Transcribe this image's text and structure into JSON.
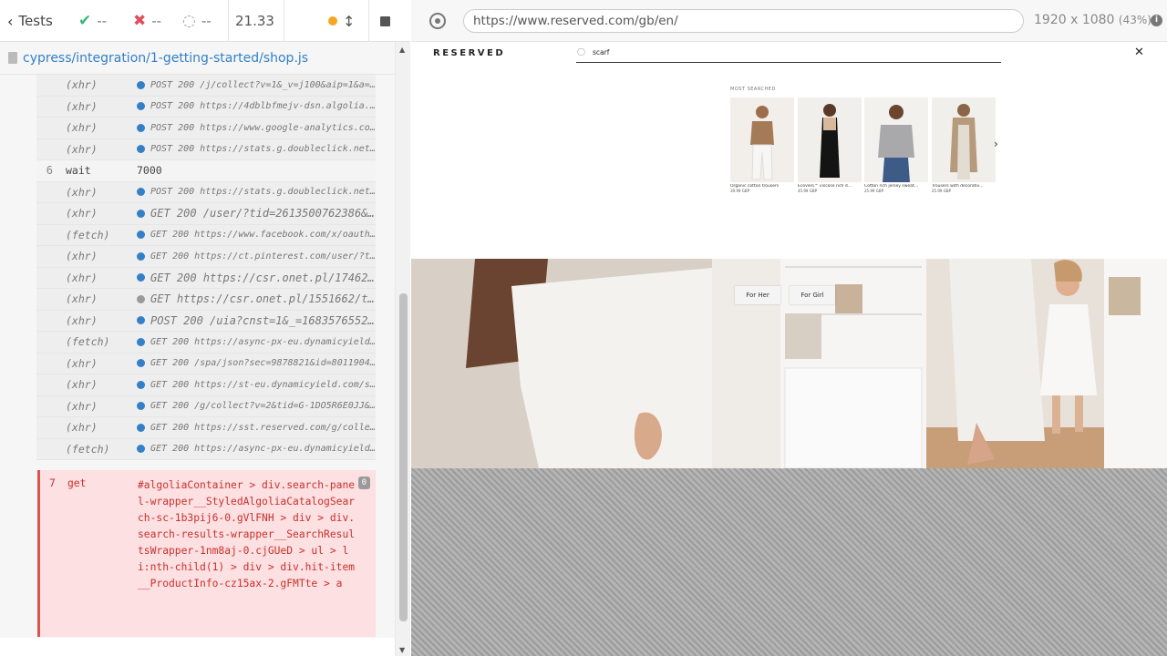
{
  "reporter": {
    "tests_label": "Tests",
    "passed": "--",
    "failed": "--",
    "pending": "--",
    "duration": "21.33",
    "spec_path": "cypress/integration/1-getting-started/shop.js"
  },
  "commands": [
    {
      "num": "",
      "name": "(xhr)",
      "msg": "POST 200 /j/collect?v=1&_v=j100&aip=1&a=1…",
      "bullet": "blue",
      "big": false
    },
    {
      "num": "",
      "name": "(xhr)",
      "msg": "POST 200 https://4dblbfmejv-dsn.algolia.n…",
      "bullet": "blue",
      "big": false
    },
    {
      "num": "",
      "name": "(xhr)",
      "msg": "POST 200 https://www.google-analytics.com…",
      "bullet": "blue",
      "big": false
    },
    {
      "num": "",
      "name": "(xhr)",
      "msg": "POST 200 https://stats.g.doubleclick.net/…",
      "bullet": "blue",
      "big": false
    },
    {
      "num": "6",
      "name": "wait",
      "msg": "7000",
      "bullet": "",
      "big": false,
      "wait": true
    },
    {
      "num": "",
      "name": "(xhr)",
      "msg": "POST 200 https://stats.g.doubleclick.net/…",
      "bullet": "blue",
      "big": false
    },
    {
      "num": "",
      "name": "(xhr)",
      "msg": "GET 200 /user/?tid=2613500762386&p…",
      "bullet": "blue",
      "big": true
    },
    {
      "num": "",
      "name": "(fetch)",
      "msg": "GET 200 https://www.facebook.com/x/oauth/…",
      "bullet": "blue",
      "big": false
    },
    {
      "num": "",
      "name": "(xhr)",
      "msg": "GET 200 https://ct.pinterest.com/user/?ti…",
      "bullet": "blue",
      "big": false
    },
    {
      "num": "",
      "name": "(xhr)",
      "msg": "GET 200 https://csr.onet.pl/174621…",
      "bullet": "blue",
      "big": true
    },
    {
      "num": "",
      "name": "(xhr)",
      "msg": "GET https://csr.onet.pl/1551662/ta…",
      "bullet": "gray",
      "big": true
    },
    {
      "num": "",
      "name": "(xhr)",
      "msg": "POST 200 /uia?cnst=1&_=16835765527…",
      "bullet": "blue",
      "big": true
    },
    {
      "num": "",
      "name": "(fetch)",
      "msg": "GET 200 https://async-px-eu.dynamicyield.…",
      "bullet": "blue",
      "big": false
    },
    {
      "num": "",
      "name": "(xhr)",
      "msg": "GET 200 /spa/json?sec=9878821&id=80119046…",
      "bullet": "blue",
      "big": false
    },
    {
      "num": "",
      "name": "(xhr)",
      "msg": "GET 200 https://st-eu.dynamicyield.com/sp…",
      "bullet": "blue",
      "big": false
    },
    {
      "num": "",
      "name": "(xhr)",
      "msg": "GET 200 /g/collect?v=2&tid=G-1DO5R6E0JJ&g…",
      "bullet": "blue",
      "big": false
    },
    {
      "num": "",
      "name": "(xhr)",
      "msg": "GET 200 https://sst.reserved.com/g/collec…",
      "bullet": "blue",
      "big": false
    },
    {
      "num": "",
      "name": "(fetch)",
      "msg": "GET 200 https://async-px-eu.dynamicyield.…",
      "bullet": "blue",
      "big": false
    }
  ],
  "failed_command": {
    "num": "7",
    "name": "get",
    "selector": "#algoliaContainer > div.search-panel-wrapper__StyledAlgoliaCatalogSearch-sc-1b3pij6-0.gVlFNH > div > div.search-results-wrapper__SearchResultsWrapper-1nm8aj-0.cjGUeD > ul > li:nth-child(1) > div > div.hit-item__ProductInfo-cz15ax-2.gFMTte > a",
    "badge": "0"
  },
  "aut_header": {
    "url": "https://www.reserved.com/gb/en/",
    "viewport": "1920 x 1080",
    "scale": "(43%)"
  },
  "site": {
    "logo": "RESERVED",
    "search_value": "scarf",
    "most_searched": "MOST SEARCHED",
    "products": [
      {
        "name": "Organic cotton trousers",
        "price": "39.99 GBP"
      },
      {
        "name": "Ecovero™ viscose rich d…",
        "price": "45.99 GBP"
      },
      {
        "name": "Cotton rich jersey sweat…",
        "price": "25.99 GBP"
      },
      {
        "name": "Trousers with decorativ…",
        "price": "25.99 GBP"
      }
    ],
    "hero_buttons": [
      "For Her",
      "For Girl"
    ]
  },
  "colors": {
    "pass": "#3bb873",
    "fail": "#e04f5f",
    "link": "#3380c8",
    "failed_bg": "#fde0e2"
  }
}
